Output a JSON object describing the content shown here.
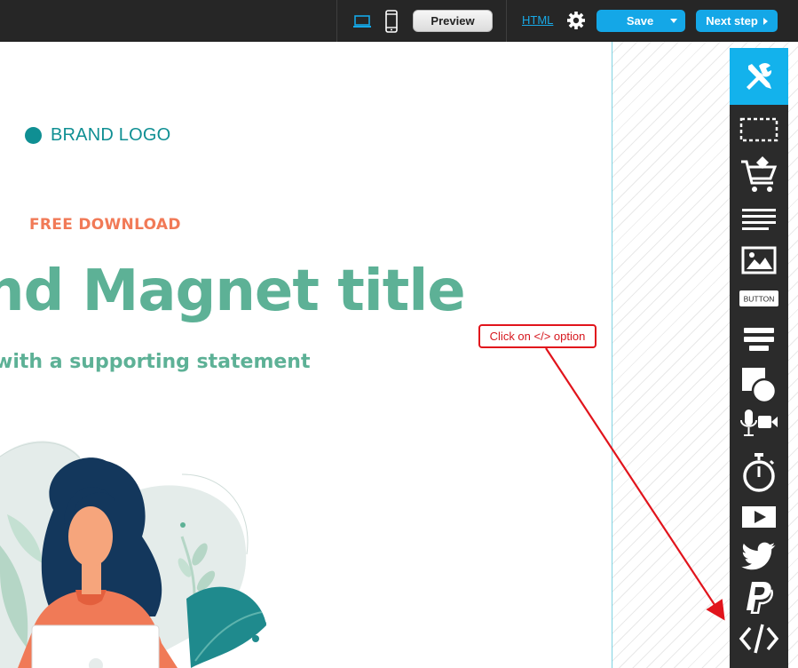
{
  "topbar": {
    "desktop_icon": "laptop-icon",
    "mobile_icon": "mobile-icon",
    "preview_label": "Preview",
    "html_label": "HTML",
    "settings_icon": "gear-icon",
    "save_label": "Save",
    "next_label": "Next step"
  },
  "page": {
    "brand_logo": "BRAND LOGO",
    "eyebrow": "FREE DOWNLOAD",
    "title": "nd Magnet title",
    "subtitle": "with a supporting statement"
  },
  "callout": {
    "text": "Click on </> option"
  },
  "toolbar": {
    "items": [
      {
        "icon": "tools-icon"
      },
      {
        "icon": "section-icon"
      },
      {
        "icon": "cart-icon"
      },
      {
        "icon": "text-icon"
      },
      {
        "icon": "image-icon"
      },
      {
        "icon": "button-icon",
        "label": "BUTTON"
      },
      {
        "icon": "form-icon"
      },
      {
        "icon": "shapes-icon"
      },
      {
        "icon": "media-recorder-icon"
      },
      {
        "icon": "timer-icon"
      },
      {
        "icon": "video-icon"
      },
      {
        "icon": "twitter-icon"
      },
      {
        "icon": "paypal-icon"
      },
      {
        "icon": "code-icon"
      }
    ]
  },
  "colors": {
    "accent_blue": "#14a7e7",
    "brand_teal": "#0f8f93",
    "title_green": "#5db196",
    "eyebrow_orange": "#f17a57",
    "callout_red": "#e1141c"
  }
}
